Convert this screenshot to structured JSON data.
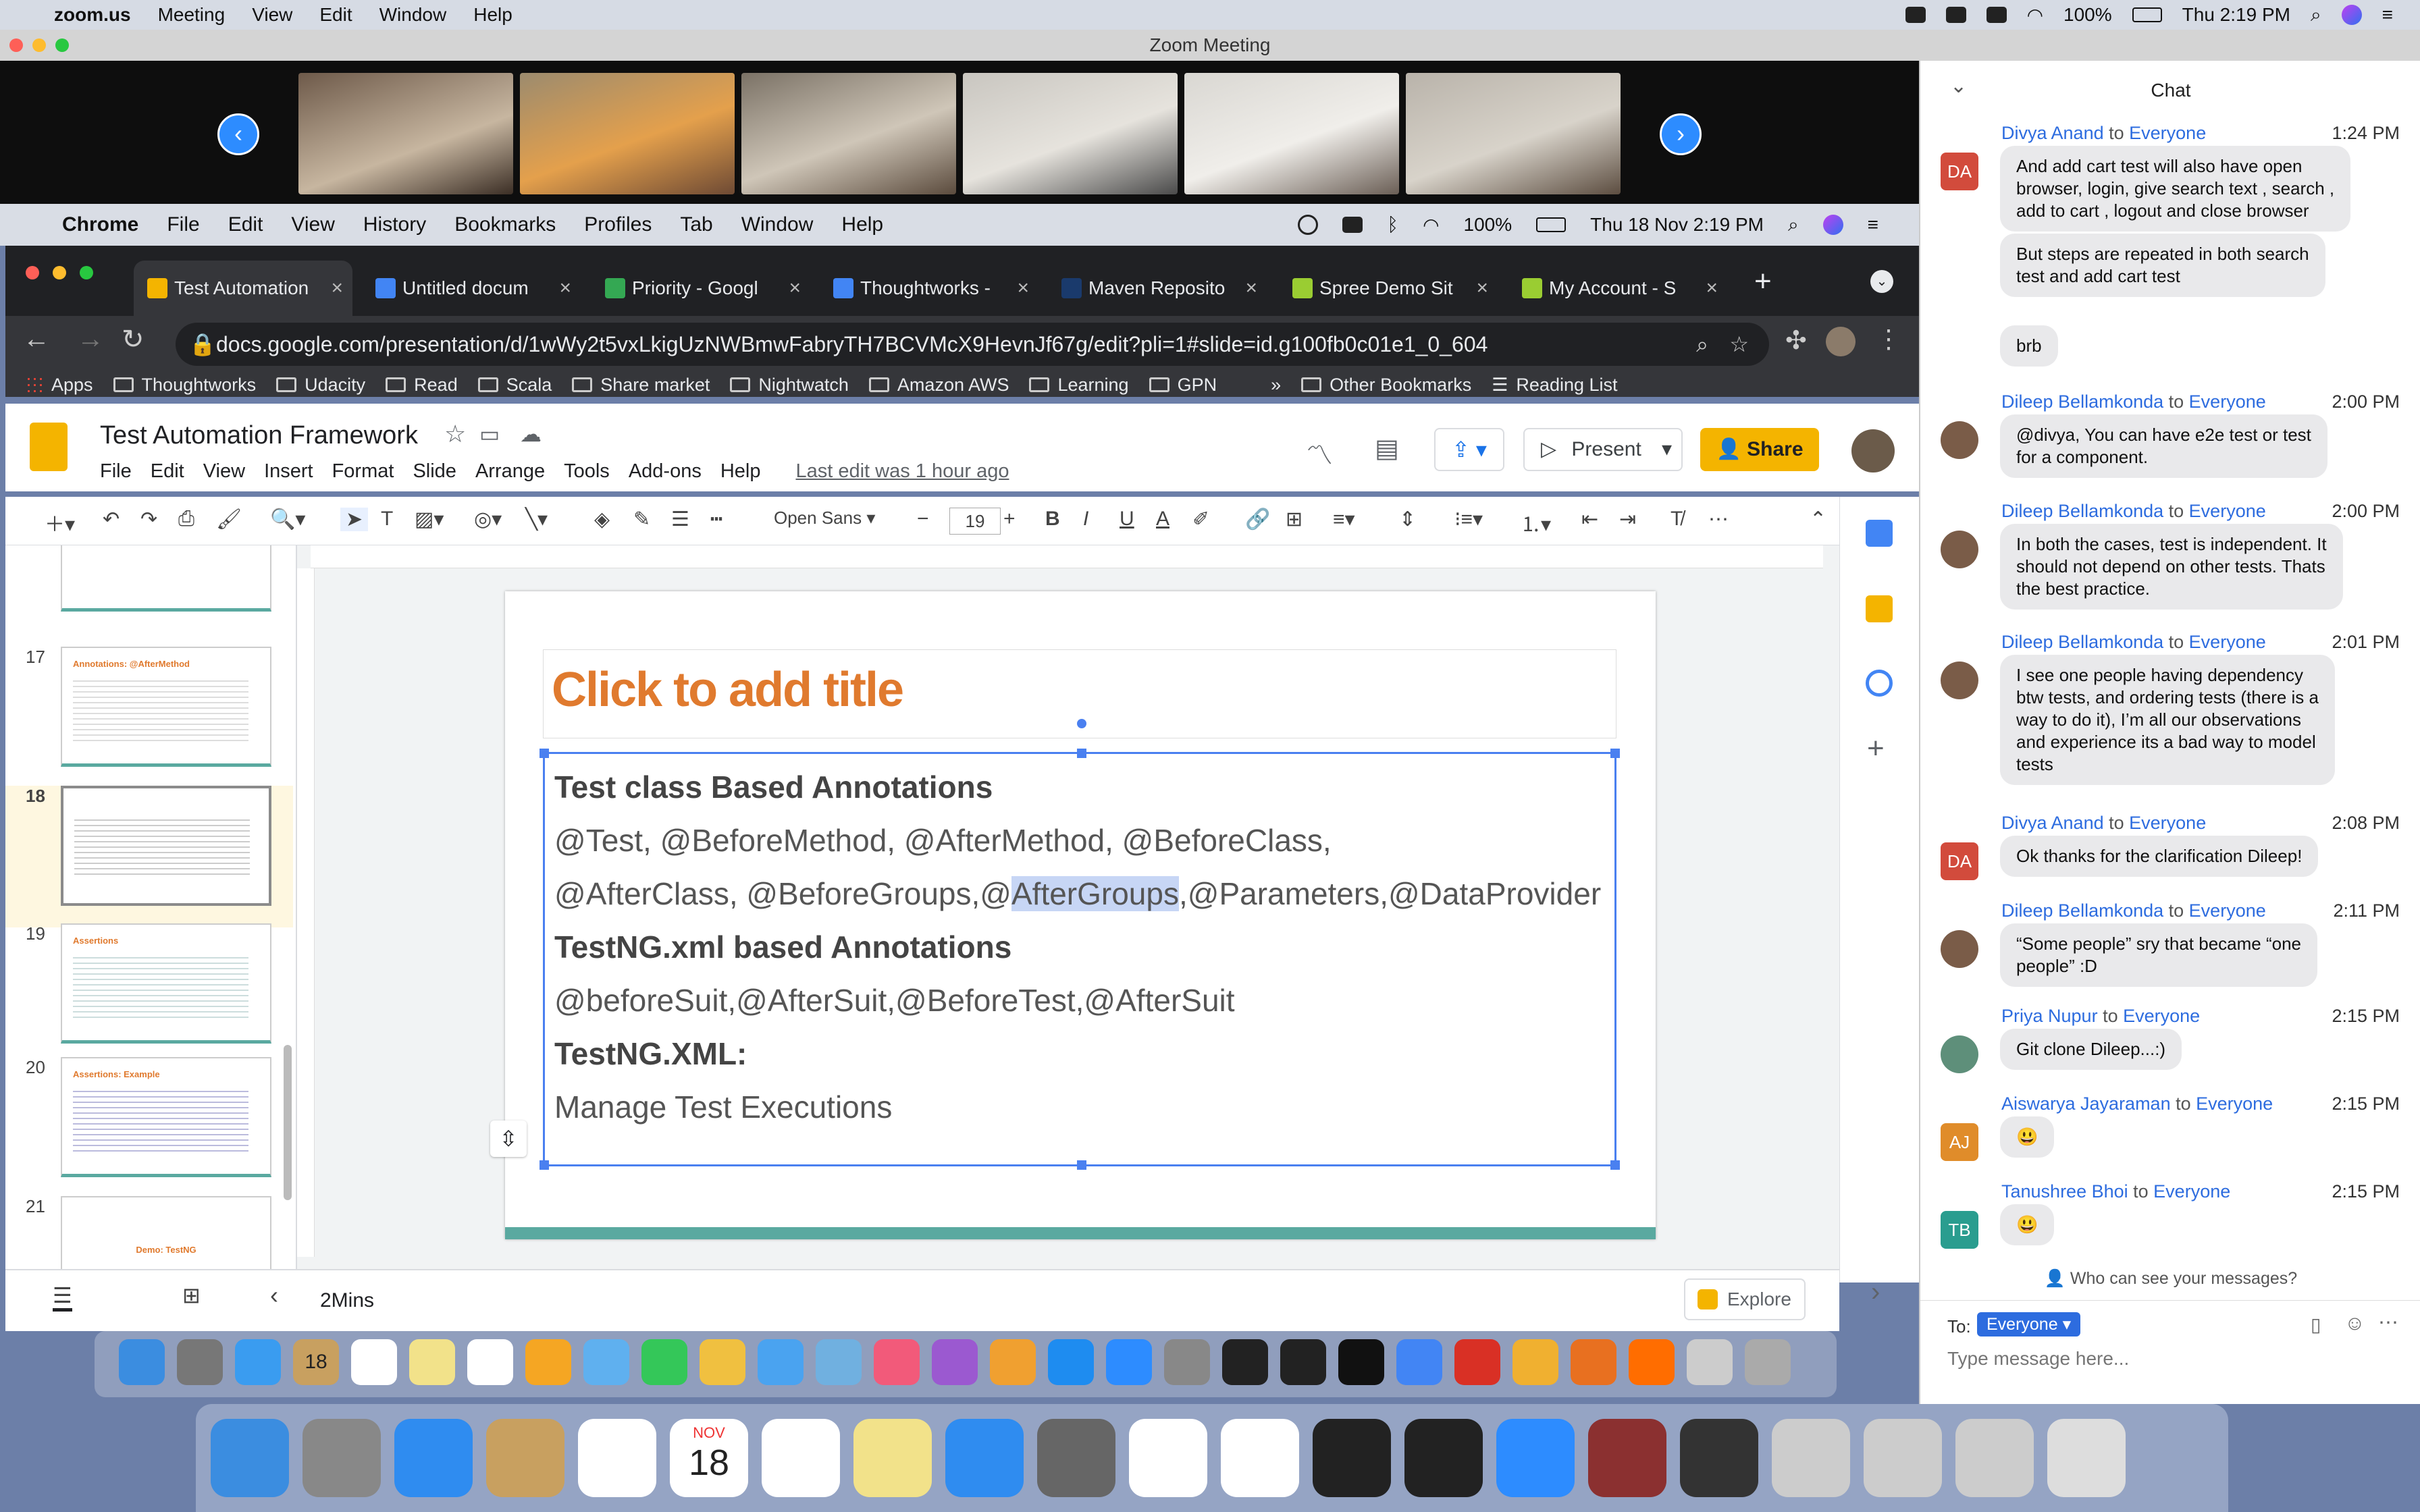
{
  "macbar": {
    "app": "zoom.us",
    "menus": [
      "Meeting",
      "View",
      "Edit",
      "Window",
      "Help"
    ],
    "battery": "100%",
    "clock": "Thu 2:19 PM"
  },
  "zoom": {
    "title": "Zoom Meeting"
  },
  "chrome_menubar": {
    "app": "Chrome",
    "menus": [
      "File",
      "Edit",
      "View",
      "History",
      "Bookmarks",
      "Profiles",
      "Tab",
      "Window",
      "Help"
    ],
    "battery": "100%",
    "clock": "Thu 18 Nov  2:19 PM"
  },
  "tabs": [
    {
      "label": "Test Automation",
      "color": "#f4b400"
    },
    {
      "label": "Untitled docum",
      "color": "#4285f4"
    },
    {
      "label": "Priority - Googl",
      "color": "#34a853"
    },
    {
      "label": "Thoughtworks -",
      "color": "#4285f4"
    },
    {
      "label": "Maven Reposito",
      "color": "#1a3a6c"
    },
    {
      "label": "Spree Demo Sit",
      "color": "#9acd32"
    },
    {
      "label": "My Account - S",
      "color": "#9acd32"
    }
  ],
  "url": "docs.google.com/presentation/d/1wWy2t5vxLkigUzNWBmwFabryTH7BCVMcX9HevnJf67g/edit?pli=1#slide=id.g100fb0c01e1_0_604",
  "bookmarks": [
    "Apps",
    "Thoughtworks",
    "Udacity",
    "Read",
    "Scala",
    "Share market",
    "Nightwatch",
    "Amazon AWS",
    "Learning",
    "GPN"
  ],
  "bookmarks_right": [
    "Other Bookmarks",
    "Reading List"
  ],
  "doc": {
    "title": "Test Automation Framework",
    "menus": [
      "File",
      "Edit",
      "View",
      "Insert",
      "Format",
      "Slide",
      "Arrange",
      "Tools",
      "Add-ons",
      "Help"
    ],
    "last_edit": "Last edit was 1 hour ago",
    "present": "Present",
    "share": "Share"
  },
  "toolbar": {
    "font": "Open Sans",
    "size": "19"
  },
  "filmstrip": {
    "numbers": [
      "17",
      "18",
      "19",
      "20",
      "21"
    ],
    "thumb17_title": "Annotations: @AfterMethod",
    "thumb19_title": "Assertions",
    "thumb20_title": "Assertions: Example",
    "thumb21_title": "Demo: TestNG"
  },
  "slide": {
    "placeholder_title": "Click to add title",
    "lines": [
      "Test class Based Annotations",
      "@Test, @BeforeMethod, @AfterMethod, @BeforeClass,",
      "@AfterClass, @BeforeGroups,@",
      "AfterGroups",
      ",@Parameters,@DataProvider",
      "TestNG.xml based Annotations",
      "@beforeSuit,@AfterSuit,@BeforeTest,@AfterSuit",
      "TestNG.XML:",
      "Manage Test Executions"
    ]
  },
  "notes": {
    "text": "2Mins",
    "explore": "Explore"
  },
  "chat": {
    "title": "Chat",
    "messages": [
      {
        "from": "Divya Anand",
        "to": "Everyone",
        "time": "1:24 PM",
        "avatar": "DA",
        "color": "#d24b3c",
        "lines": [
          "And add cart test will also have open",
          "browser, login, give search text , search ,",
          "add to cart , logout and close browser"
        ]
      },
      {
        "from": "",
        "to": "",
        "time": "",
        "avatar": "",
        "color": "",
        "lines": [
          "But steps are repeated in both search",
          "test and add cart test"
        ]
      },
      {
        "from": "",
        "to": "",
        "time": "",
        "avatar": "",
        "color": "",
        "lines": [
          "brb"
        ]
      },
      {
        "from": "Dileep Bellamkonda",
        "to": "Everyone",
        "time": "2:00 PM",
        "avatar": "",
        "color": "#7a5c48",
        "lines": [
          "@divya, You can have e2e test or test",
          "for a component."
        ]
      },
      {
        "from": "Dileep Bellamkonda",
        "to": "Everyone",
        "time": "2:00 PM",
        "avatar": "",
        "color": "#7a5c48",
        "lines": [
          "In both the cases, test is independent. It",
          "should not depend on other tests. Thats",
          "the best practice."
        ]
      },
      {
        "from": "Dileep Bellamkonda",
        "to": "Everyone",
        "time": "2:01 PM",
        "avatar": "",
        "color": "#7a5c48",
        "lines": [
          "I see one people having dependency",
          "btw tests, and ordering tests (there is a",
          "way to do it), I’m all our observations",
          "and experience its a bad way to model",
          "tests"
        ]
      },
      {
        "from": "Divya Anand",
        "to": "Everyone",
        "time": "2:08 PM",
        "avatar": "DA",
        "color": "#d24b3c",
        "lines": [
          "Ok thanks for the clarification Dileep!"
        ]
      },
      {
        "from": "Dileep Bellamkonda",
        "to": "Everyone",
        "time": "2:11 PM",
        "avatar": "",
        "color": "#7a5c48",
        "lines": [
          "“Some people” sry that became “one",
          "people” :D"
        ]
      },
      {
        "from": "Priya Nupur",
        "to": "Everyone",
        "time": "2:15 PM",
        "avatar": "",
        "color": "#5e8f7a",
        "lines": [
          "Git clone Dileep...:)"
        ]
      },
      {
        "from": "Aiswarya Jayaraman",
        "to": "Everyone",
        "time": "2:15 PM",
        "avatar": "AJ",
        "color": "#e08c2a",
        "lines": [
          "😃"
        ]
      },
      {
        "from": "Tanushree Bhoi",
        "to": "Everyone",
        "time": "2:15 PM",
        "avatar": "TB",
        "color": "#2a9d8f",
        "lines": [
          "😃"
        ]
      }
    ],
    "privacy": "Who can see your messages?",
    "to_label": "To:",
    "to_value": "Everyone",
    "placeholder": "Type message here..."
  },
  "dock_date": {
    "month": "NOV",
    "day": "18"
  },
  "dock1_date": "18"
}
